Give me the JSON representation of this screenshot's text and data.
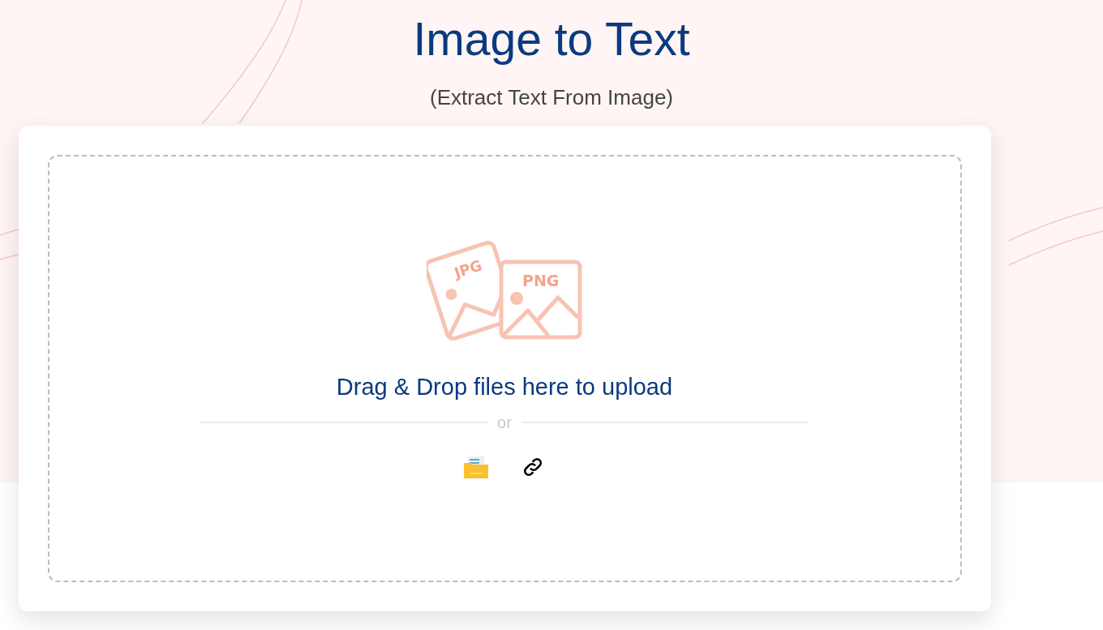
{
  "header": {
    "title": "Image to Text",
    "subtitle": "(Extract Text From Image)"
  },
  "upload": {
    "illustration_labels": [
      "JPG",
      "PNG"
    ],
    "prompt": "Drag & Drop files here to upload",
    "separator": "or",
    "sources": [
      {
        "kind": "folder"
      },
      {
        "kind": "link"
      }
    ]
  }
}
